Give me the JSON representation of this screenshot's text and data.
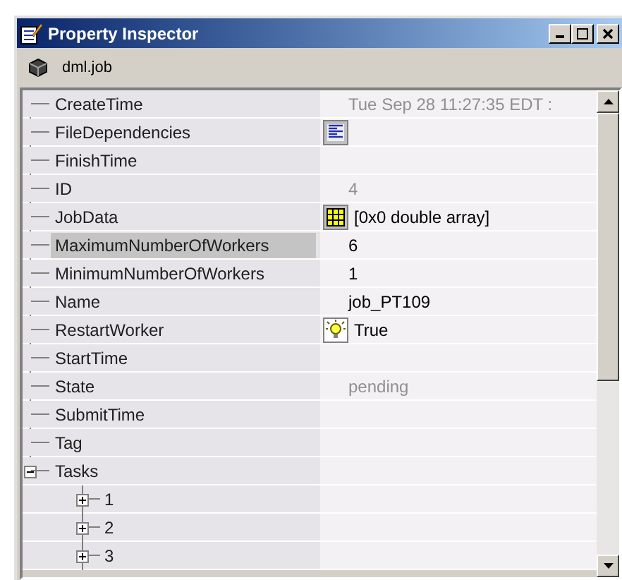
{
  "window": {
    "title": "Property Inspector"
  },
  "object": {
    "label": "dml.job"
  },
  "properties": [
    {
      "name": "CreateTime",
      "value": "Tue Sep 28 11:27:35 EDT :",
      "kind": "text",
      "readonly": true,
      "selected": false
    },
    {
      "name": "FileDependencies",
      "kind": "list",
      "selected": false
    },
    {
      "name": "FinishTime",
      "selected": false
    },
    {
      "name": "ID",
      "value": "4",
      "kind": "text",
      "readonly": true,
      "selected": false
    },
    {
      "name": "JobData",
      "value": "[0x0  double array]",
      "kind": "array",
      "readonly": false,
      "selected": false
    },
    {
      "name": "MaximumNumberOfWorkers",
      "value": "6",
      "kind": "text",
      "readonly": false,
      "selected": true
    },
    {
      "name": "MinimumNumberOfWorkers",
      "value": "1",
      "kind": "text",
      "readonly": false,
      "selected": false
    },
    {
      "name": "Name",
      "value": "job_PT109",
      "kind": "text",
      "readonly": false,
      "selected": false
    },
    {
      "name": "RestartWorker",
      "value": "True",
      "kind": "boolean",
      "readonly": false,
      "selected": false
    },
    {
      "name": "StartTime",
      "selected": false
    },
    {
      "name": "State",
      "value": "pending",
      "kind": "text",
      "readonly": true,
      "selected": false
    },
    {
      "name": "SubmitTime",
      "selected": false
    },
    {
      "name": "Tag",
      "selected": false
    },
    {
      "name": "Tasks",
      "selected": false,
      "expanded": true,
      "children": [
        {
          "name": "1",
          "selected": false,
          "expanded": false
        },
        {
          "name": "2",
          "selected": false,
          "expanded": false
        },
        {
          "name": "3",
          "selected": false,
          "expanded": false
        }
      ]
    }
  ]
}
